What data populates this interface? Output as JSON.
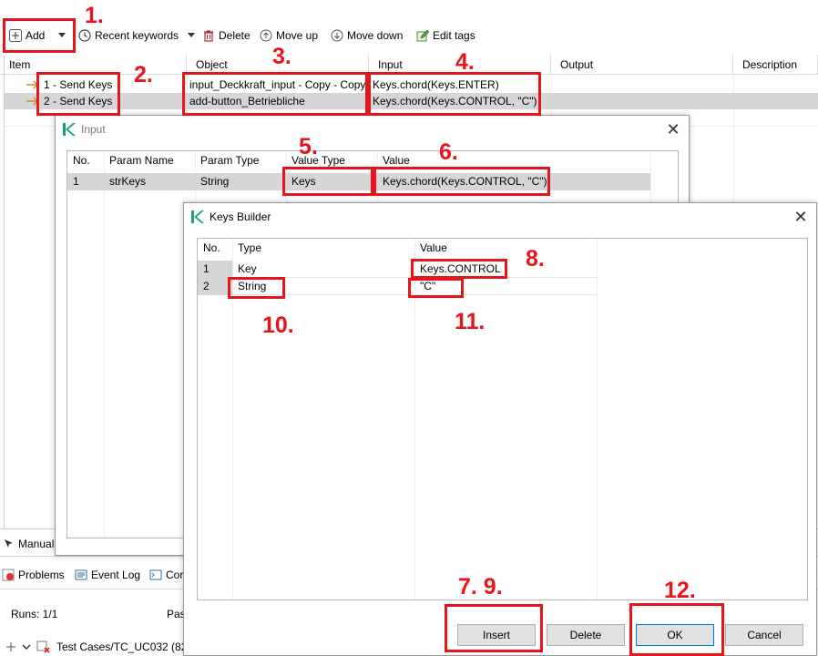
{
  "toolbar": {
    "add": "Add",
    "recent_keywords": "Recent keywords",
    "delete": "Delete",
    "move_up": "Move up",
    "move_down": "Move down",
    "edit_tags": "Edit tags"
  },
  "main_table": {
    "headers": [
      "Item",
      "Object",
      "Input",
      "Output",
      "Description"
    ],
    "rows": [
      {
        "item": "1 - Send Keys",
        "object": "input_Deckkraft_input - Copy - Copy",
        "input": "Keys.chord(Keys.ENTER)"
      },
      {
        "item": "2 - Send Keys",
        "object": "add-button_Betriebliche",
        "input": "Keys.chord(Keys.CONTROL, \"C\")"
      }
    ]
  },
  "input_dialog": {
    "title": "Input",
    "headers": [
      "No.",
      "Param Name",
      "Param Type",
      "Value Type",
      "Value"
    ],
    "rows": [
      {
        "no": "1",
        "param_name": "strKeys",
        "param_type": "String",
        "value_type": "Keys",
        "value": "Keys.chord(Keys.CONTROL, \"C\")"
      }
    ]
  },
  "keys_builder": {
    "title": "Keys Builder",
    "headers": [
      "No.",
      "Type",
      "Value"
    ],
    "rows": [
      {
        "no": "1",
        "type": "Key",
        "value": "Keys.CONTROL"
      },
      {
        "no": "2",
        "type": "String",
        "value": "\"C\""
      }
    ],
    "buttons": {
      "insert": "Insert",
      "delete": "Delete",
      "ok": "OK",
      "cancel": "Cancel"
    }
  },
  "bottom": {
    "manual_tab": "Manual",
    "problems_tab": "Problems",
    "event_log_tab": "Event Log",
    "console_tab_partial": "Cor",
    "runs": "Runs: 1/1",
    "passes_partial": "Pas",
    "tree_item": "Test Cases/TC_UC032 (82"
  },
  "annotations": [
    "1.",
    "2.",
    "3.",
    "4.",
    "5.",
    "6.",
    "7. 9.",
    "8.",
    "10.",
    "11.",
    "12."
  ],
  "colors": {
    "annotation": "#e8141c",
    "selection": "#d6d6d6",
    "primary_border": "#0078d7"
  }
}
